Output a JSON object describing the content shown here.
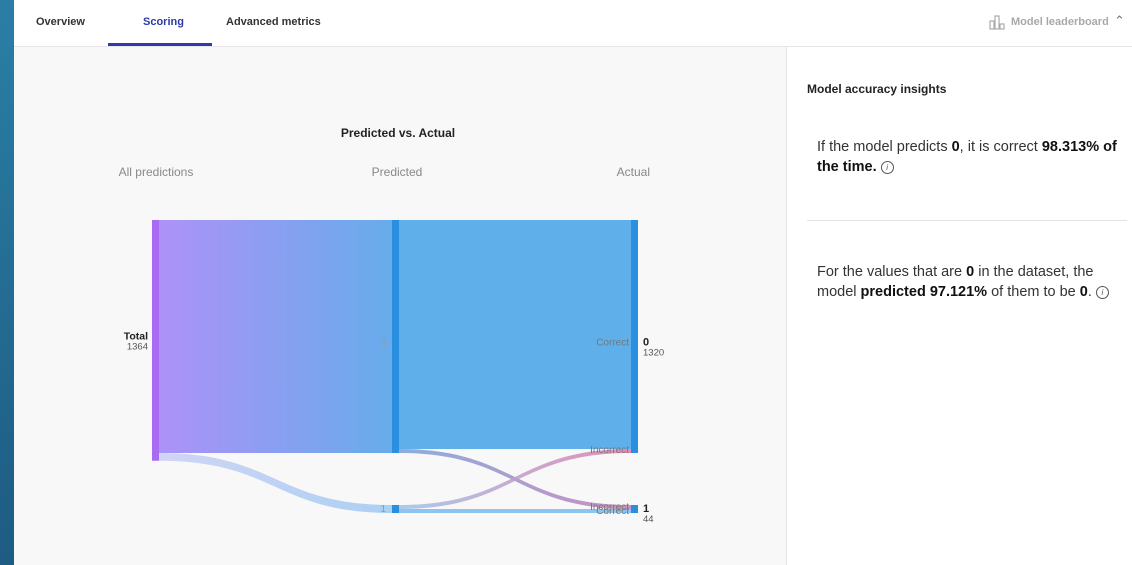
{
  "tabs": {
    "overview": "Overview",
    "scoring": "Scoring",
    "advanced": "Advanced metrics",
    "leaderboard": "Model leaderboard"
  },
  "side": {
    "title": "Model accuracy insights",
    "insight1": {
      "a": "If the model predicts ",
      "b": "0",
      "c": ", it is correct ",
      "d": "98.313% of the time.",
      "icon": "i"
    },
    "insight2": {
      "a": "For the values that are ",
      "b": "0",
      "c": " in the dataset, the model ",
      "d": "predicted 97.121%",
      "e": " of them to be ",
      "f": "0",
      "g": ".",
      "icon": "i"
    }
  },
  "chart_data": {
    "type": "sankey",
    "title": "Predicted vs. Actual",
    "columns": [
      "All predictions",
      "Predicted",
      "Actual"
    ],
    "total": {
      "label": "Total",
      "value": 1364
    },
    "predicted": [
      {
        "label": "0",
        "value": 1320
      },
      {
        "label": "1",
        "value": 44
      }
    ],
    "actual": [
      {
        "label": "0",
        "value": 1320
      },
      {
        "label": "1",
        "value": 44
      }
    ],
    "links": [
      {
        "from": "Total",
        "to": "Predicted 0",
        "value": 1320
      },
      {
        "from": "Total",
        "to": "Predicted 1",
        "value": 44
      },
      {
        "from": "Predicted 0",
        "to": "Actual 0",
        "status": "Correct"
      },
      {
        "from": "Predicted 0",
        "to": "Actual 1",
        "status": "Incorrect"
      },
      {
        "from": "Predicted 1",
        "to": "Actual 0",
        "status": "Incorrect"
      },
      {
        "from": "Predicted 1",
        "to": "Actual 1",
        "status": "Correct"
      }
    ],
    "link_labels": [
      "Correct",
      "Incorrect",
      "Incorrect",
      "Correct"
    ],
    "colors": {
      "node": "#2b8fe0",
      "total_node": "#a86cf2",
      "main_flow_start": "#a98cf7",
      "main_flow_end": "#5fa8ea",
      "incorrect": "#d87fb6",
      "correct_small": "#8cc6f0"
    }
  }
}
